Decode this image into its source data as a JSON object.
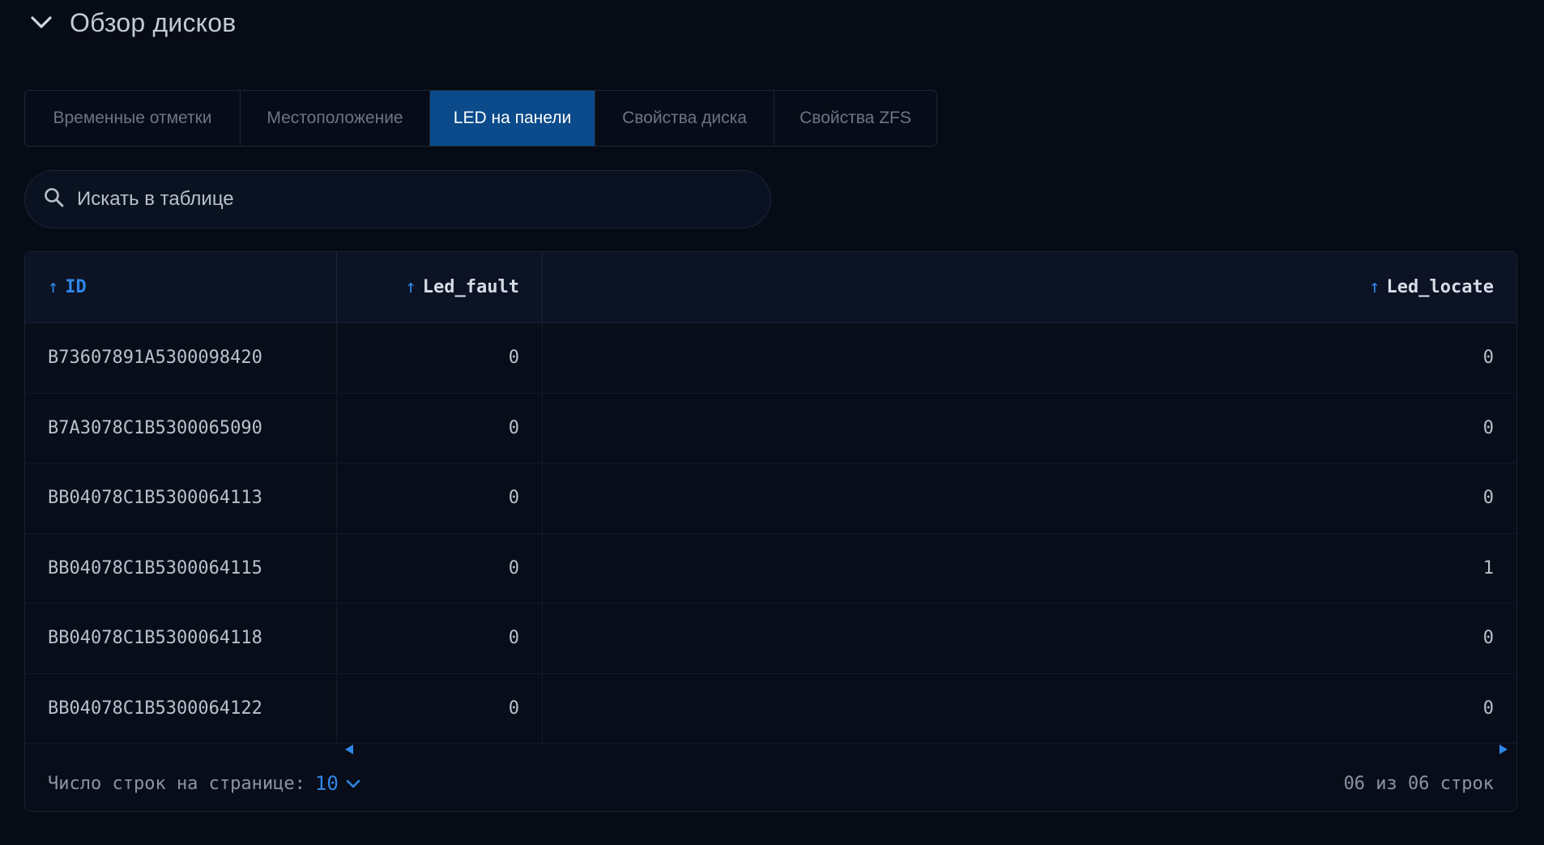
{
  "section": {
    "title": "Обзор дисков",
    "chevron_icon": "chevron-down-icon"
  },
  "tabs": [
    {
      "label": "Временные отметки",
      "active": false
    },
    {
      "label": "Местоположение",
      "active": false
    },
    {
      "label": "LED на панели",
      "active": true
    },
    {
      "label": "Свойства диска",
      "active": false
    },
    {
      "label": "Свойства ZFS",
      "active": false
    }
  ],
  "search": {
    "placeholder": "Искать в таблице",
    "icon": "search-icon"
  },
  "table": {
    "columns": [
      {
        "label": "ID",
        "sort": "asc"
      },
      {
        "label": "Led_fault",
        "sort": "asc"
      },
      {
        "label": "Led_locate",
        "sort": "asc"
      }
    ],
    "rows": [
      [
        "B73607891A5300098420",
        "0",
        "0"
      ],
      [
        "B7A3078C1B5300065090",
        "0",
        "0"
      ],
      [
        "BB04078C1B5300064113",
        "0",
        "0"
      ],
      [
        "BB04078C1B5300064115",
        "0",
        "1"
      ],
      [
        "BB04078C1B5300064118",
        "0",
        "0"
      ],
      [
        "BB04078C1B5300064122",
        "0",
        "0"
      ]
    ]
  },
  "footer": {
    "rows_per_page_label": "Число строк на странице:",
    "rows_per_page_value": "10",
    "count_text": "06 из 06 строк"
  },
  "colors": {
    "accent": "#2f86e8",
    "active_tab": "#0b4a8b",
    "background": "#060b16"
  }
}
